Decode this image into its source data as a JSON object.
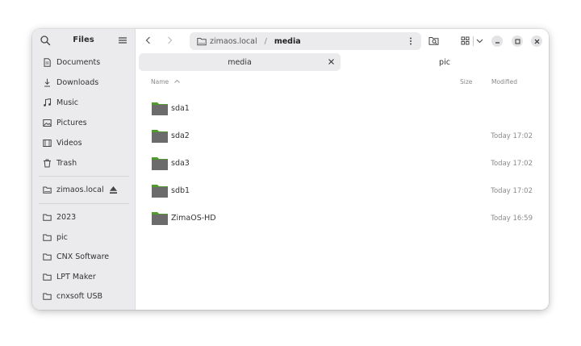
{
  "sidebar": {
    "title": "Files",
    "places": [
      {
        "label": "Documents",
        "icon": "document-icon"
      },
      {
        "label": "Downloads",
        "icon": "download-icon"
      },
      {
        "label": "Music",
        "icon": "music-icon"
      },
      {
        "label": "Pictures",
        "icon": "picture-icon"
      },
      {
        "label": "Videos",
        "icon": "video-icon"
      },
      {
        "label": "Trash",
        "icon": "trash-icon"
      }
    ],
    "network": {
      "label": "zimaos.local",
      "icon": "network-folder-icon"
    },
    "bookmarks": [
      {
        "label": "2023"
      },
      {
        "label": "pic"
      },
      {
        "label": "CNX Software"
      },
      {
        "label": "LPT Maker"
      },
      {
        "label": "cnxsoft USB"
      }
    ]
  },
  "path": {
    "host": "zimaos.local",
    "separator": "/",
    "current": "media"
  },
  "tabs": [
    {
      "label": "media",
      "active": true
    },
    {
      "label": "pic",
      "active": false
    }
  ],
  "columns": {
    "name": "Name",
    "size": "Size",
    "modified": "Modified"
  },
  "files": [
    {
      "name": "sda1",
      "modified": ""
    },
    {
      "name": "sda2",
      "modified": "Today 17:02"
    },
    {
      "name": "sda3",
      "modified": "Today 17:02"
    },
    {
      "name": "sdb1",
      "modified": "Today 17:02"
    },
    {
      "name": "ZimaOS-HD",
      "modified": "Today 16:59"
    }
  ],
  "colors": {
    "sidebar_bg": "#ebebed",
    "folder_body": "#6b6b6b",
    "folder_tab": "#4e9a2c"
  }
}
